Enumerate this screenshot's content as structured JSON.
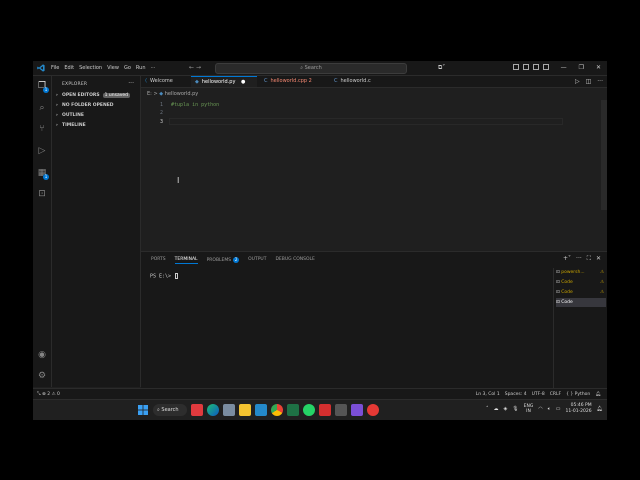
{
  "menu": [
    "File",
    "Edit",
    "Selection",
    "View",
    "Go",
    "Run",
    "···"
  ],
  "search": {
    "label": "Search"
  },
  "sidebar": {
    "header": "EXPLORER",
    "open_editors": "OPEN EDITORS",
    "unsaved": "1 unsaved",
    "no_folder": "NO FOLDER OPENED",
    "outline": "OUTLINE",
    "timeline": "TIMELINE"
  },
  "tabs": [
    {
      "label": "Welcome",
      "color": "#cccccc"
    },
    {
      "label": "helloworld.py",
      "color": "#ffffff",
      "dirty": "●"
    },
    {
      "label": "helloworld.cpp 2",
      "color": "#f48771"
    },
    {
      "label": "helloworld.c",
      "color": "#cccccc"
    }
  ],
  "breadcrumb": {
    "drive": "E:",
    "sep": ">",
    "file": "helloworld.py"
  },
  "editor": {
    "line_numbers": [
      "1",
      "2",
      "3"
    ],
    "lines": [
      "#tupla in python",
      "",
      ""
    ]
  },
  "panel": {
    "tabs": [
      "PORTS",
      "TERMINAL",
      "PROBLEMS",
      "OUTPUT",
      "DEBUG CONSOLE"
    ],
    "problems_count": "2",
    "prompt": "PS E:\\> ",
    "terminals": [
      {
        "label": "powersh...",
        "warn": true
      },
      {
        "label": "Code",
        "warn": true
      },
      {
        "label": "Code",
        "warn": true
      },
      {
        "label": "Code",
        "warn": false
      }
    ]
  },
  "statusbar": {
    "left": "⊗ 2 ⚠ 0",
    "position": "Ln 3, Col 1",
    "spaces": "Spaces: 4",
    "encoding": "UTF-8",
    "eol": "CRLF",
    "language": "{ } Python"
  },
  "taskbar": {
    "search_label": "Search",
    "lang1": "ENG",
    "lang2": "IN",
    "time": "05:46 PM",
    "date": "11-01-2026"
  },
  "colors": {
    "accent": "#0078d4",
    "comment": "#6a9955",
    "error": "#f48771",
    "warning": "#cca700"
  }
}
